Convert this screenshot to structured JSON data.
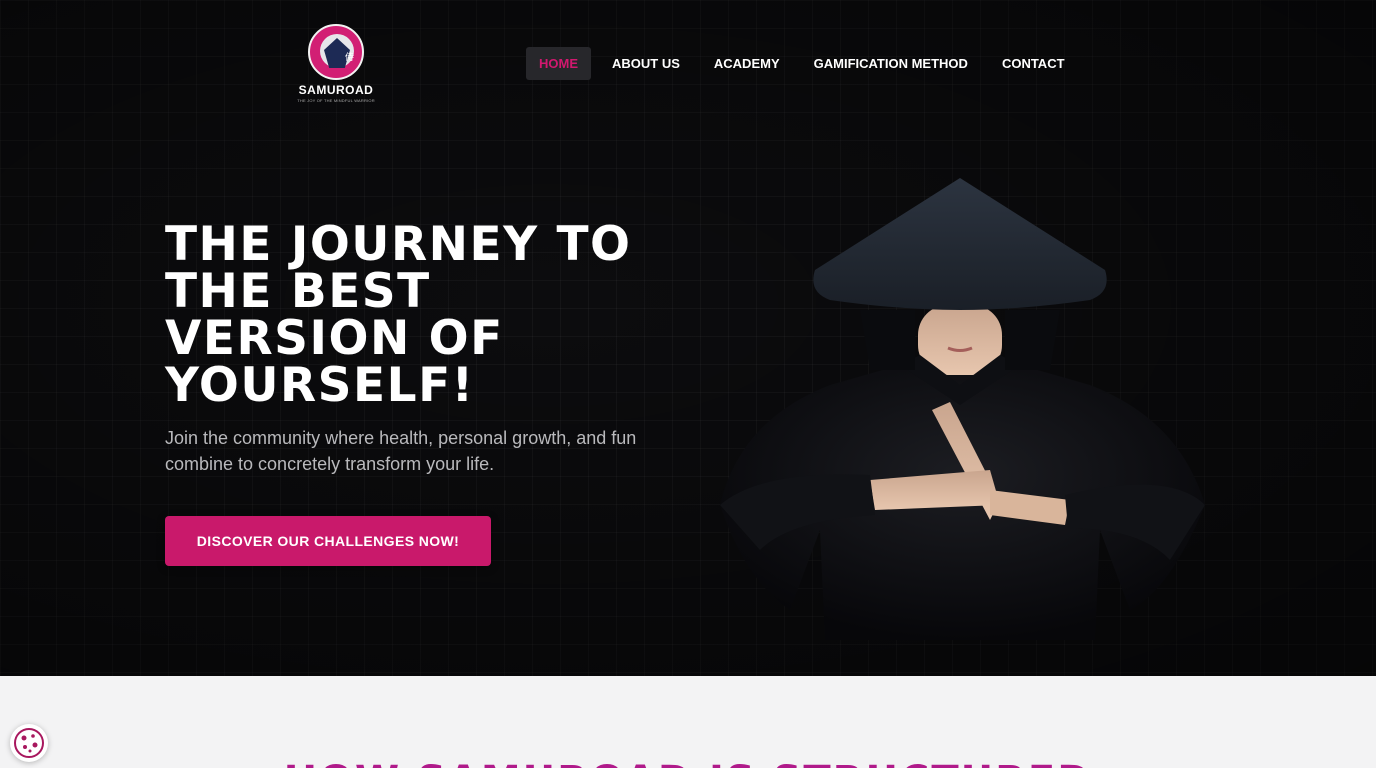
{
  "brand": {
    "name": "SAMUROAD",
    "tagline": "THE JOY OF THE MINDFUL WARRIOR"
  },
  "nav": {
    "items": [
      {
        "label": "HOME",
        "active": true
      },
      {
        "label": "ABOUT US",
        "active": false
      },
      {
        "label": "ACADEMY",
        "active": false
      },
      {
        "label": "GAMIFICATION METHOD",
        "active": false
      },
      {
        "label": "CONTACT",
        "active": false
      }
    ]
  },
  "hero": {
    "headline_lines": [
      "THE JOURNEY TO",
      "THE BEST",
      "VERSION OF",
      "YOURSELF!"
    ],
    "subtext_lines": [
      "Join the community where health, personal growth, and fun",
      "combine to concretely transform your life."
    ],
    "cta_label": "DISCOVER OUR CHALLENGES NOW!"
  },
  "section2": {
    "title": "HOW SAMUROAD IS STRUCTURED"
  },
  "icons": {
    "logo": "samurai-logo-icon",
    "cookie": "cookie-icon"
  },
  "colors": {
    "accent": "#c9196b",
    "active_nav": "#d2186f",
    "section_title": "#b01a8a",
    "background": "#0c0c0e"
  }
}
